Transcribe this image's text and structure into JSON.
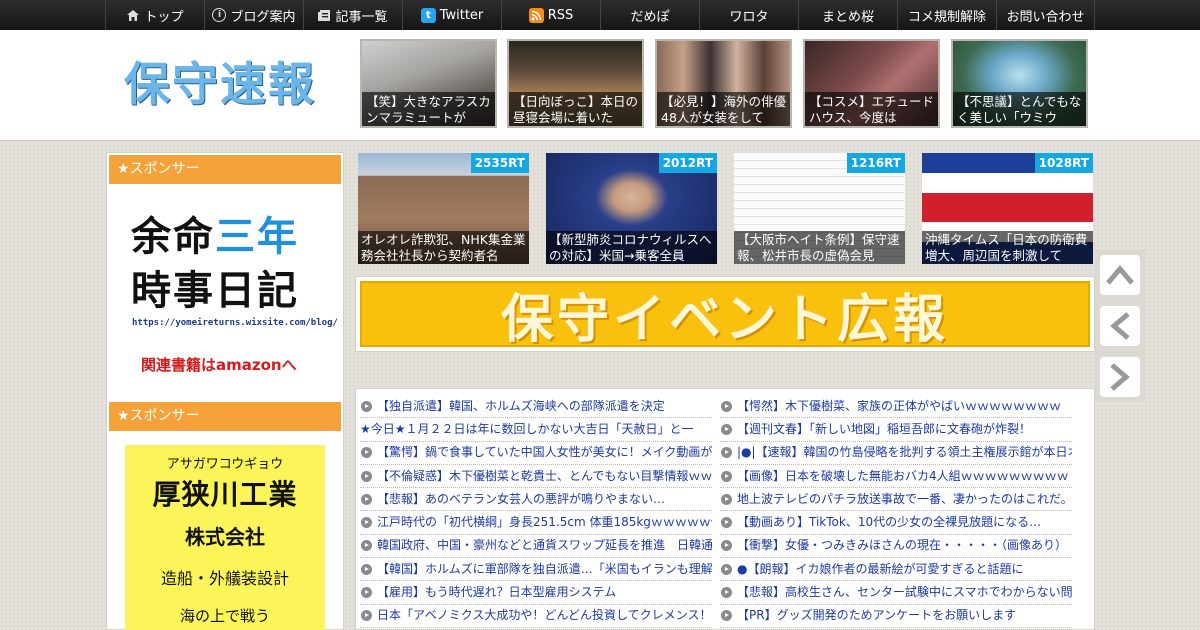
{
  "nav": [
    {
      "label": "トップ",
      "icon": "home-icon"
    },
    {
      "label": "ブログ案内",
      "icon": "info-icon"
    },
    {
      "label": "記事一覧",
      "icon": "list-icon"
    },
    {
      "label": "Twitter",
      "icon": "twitter-icon"
    },
    {
      "label": "RSS",
      "icon": "rss-icon"
    },
    {
      "label": "だめぽ",
      "icon": ""
    },
    {
      "label": "ワロタ",
      "icon": ""
    },
    {
      "label": "まとめ桜",
      "icon": ""
    },
    {
      "label": "コメ規制解除",
      "icon": ""
    },
    {
      "label": "お問い合わせ",
      "icon": ""
    }
  ],
  "logo": {
    "text": "保守速報"
  },
  "header_thumbs": [
    {
      "caption": "【笑】大きなアラスカンマラミュートが"
    },
    {
      "caption": "【日向ぼっこ】本日の昼寝会場に着いた"
    },
    {
      "caption": "【必見！】海外の俳優48人が女装をして"
    },
    {
      "caption": "【コスメ】エチュードハウス、今度は"
    },
    {
      "caption": "【不思議】とんでもなく美しい「ウミウ"
    }
  ],
  "sidebar": {
    "sponsor_label": "★スポンサー",
    "ad1": {
      "line1a": "余命",
      "line1b": "三年",
      "line2": "時事日記",
      "url": "https://yomeireturns.wixsite.com/blog/",
      "amazon": "関連書籍はamazonへ"
    },
    "sponsor_label_2": "★スポンサー",
    "ad2": {
      "kana": "アサガワコウギョウ",
      "company": "厚狭川工業",
      "kk": "株式会社",
      "business": "造船・外艤装設計",
      "more": "海の上で戦う"
    }
  },
  "featured": [
    {
      "rt": "2535RT",
      "caption": "オレオレ詐欺犯、NHK集金業務会社社長から契約者名"
    },
    {
      "rt": "2012RT",
      "caption": "【新型肺炎コロナウィルスへの対応】米国→乗客全員"
    },
    {
      "rt": "1216RT",
      "caption": "【大阪市ヘイト条例】保守速報、松井市長の虚偽会見"
    },
    {
      "rt": "1028RT",
      "caption": "沖縄タイムス「日本の防衛費増大、周辺国を刺激して"
    }
  ],
  "event_banner": {
    "text": "保守イベント広報"
  },
  "news_left": [
    "【独自派遣】韓国、ホルムズ海峡への部隊派遣を決定",
    "★今日★１月２２日は年に数回しかない大吉日「天赦日」と一",
    "【驚愕】鍋で食事していた中国人女性が美女に！メイク動画が",
    "【不倫疑惑】木下優樹菜と乾貴士、とんでもない目撃情報ｗｗ",
    "【悲報】あのベテラン女芸人の悪評が鳴りやまない…",
    "江戸時代の「初代横綱」身長251.5cm 体重185kgｗｗｗｗｗ他",
    "韓国政府、中国・豪州などと通貨スワップ延長を推進　日韓通",
    "【韓国】ホルムズに軍部隊を独自派遣…「米国もイランも理解",
    "【雇用】もう時代遅れ？日本型雇用システム",
    "日本「アベノミクス大成功や！どんどん投資してクレメンス！"
  ],
  "news_right": [
    "【愕然】木下優樹菜、家族の正体がやばいｗｗｗｗｗｗｗｗ",
    "【週刊文春】「新しい地図」稲垣吾郎に文春砲が炸裂！",
    "|●|【速報】韓国の竹島侵略を批判する領土主権展示館が本日オ",
    "【画像】日本を破壊した無能おバカ4人組ｗｗｗｗｗｗｗｗｗ",
    "地上波テレビのパチラ放送事故で一番、凄かったのはこれだ。",
    "【動画あり】TikTok、10代の少女の全裸見放題になる…",
    "【衝撃】女優・つみきみほさんの現在・・・・・（画像あり）",
    "●【朗報】イカ娘作者の最新絵が可愛すぎると話題に",
    "【悲報】高校生さん、センター試験中にスマホでわからない問",
    "【PR】グッズ開発のためアンケートをお願いします"
  ]
}
